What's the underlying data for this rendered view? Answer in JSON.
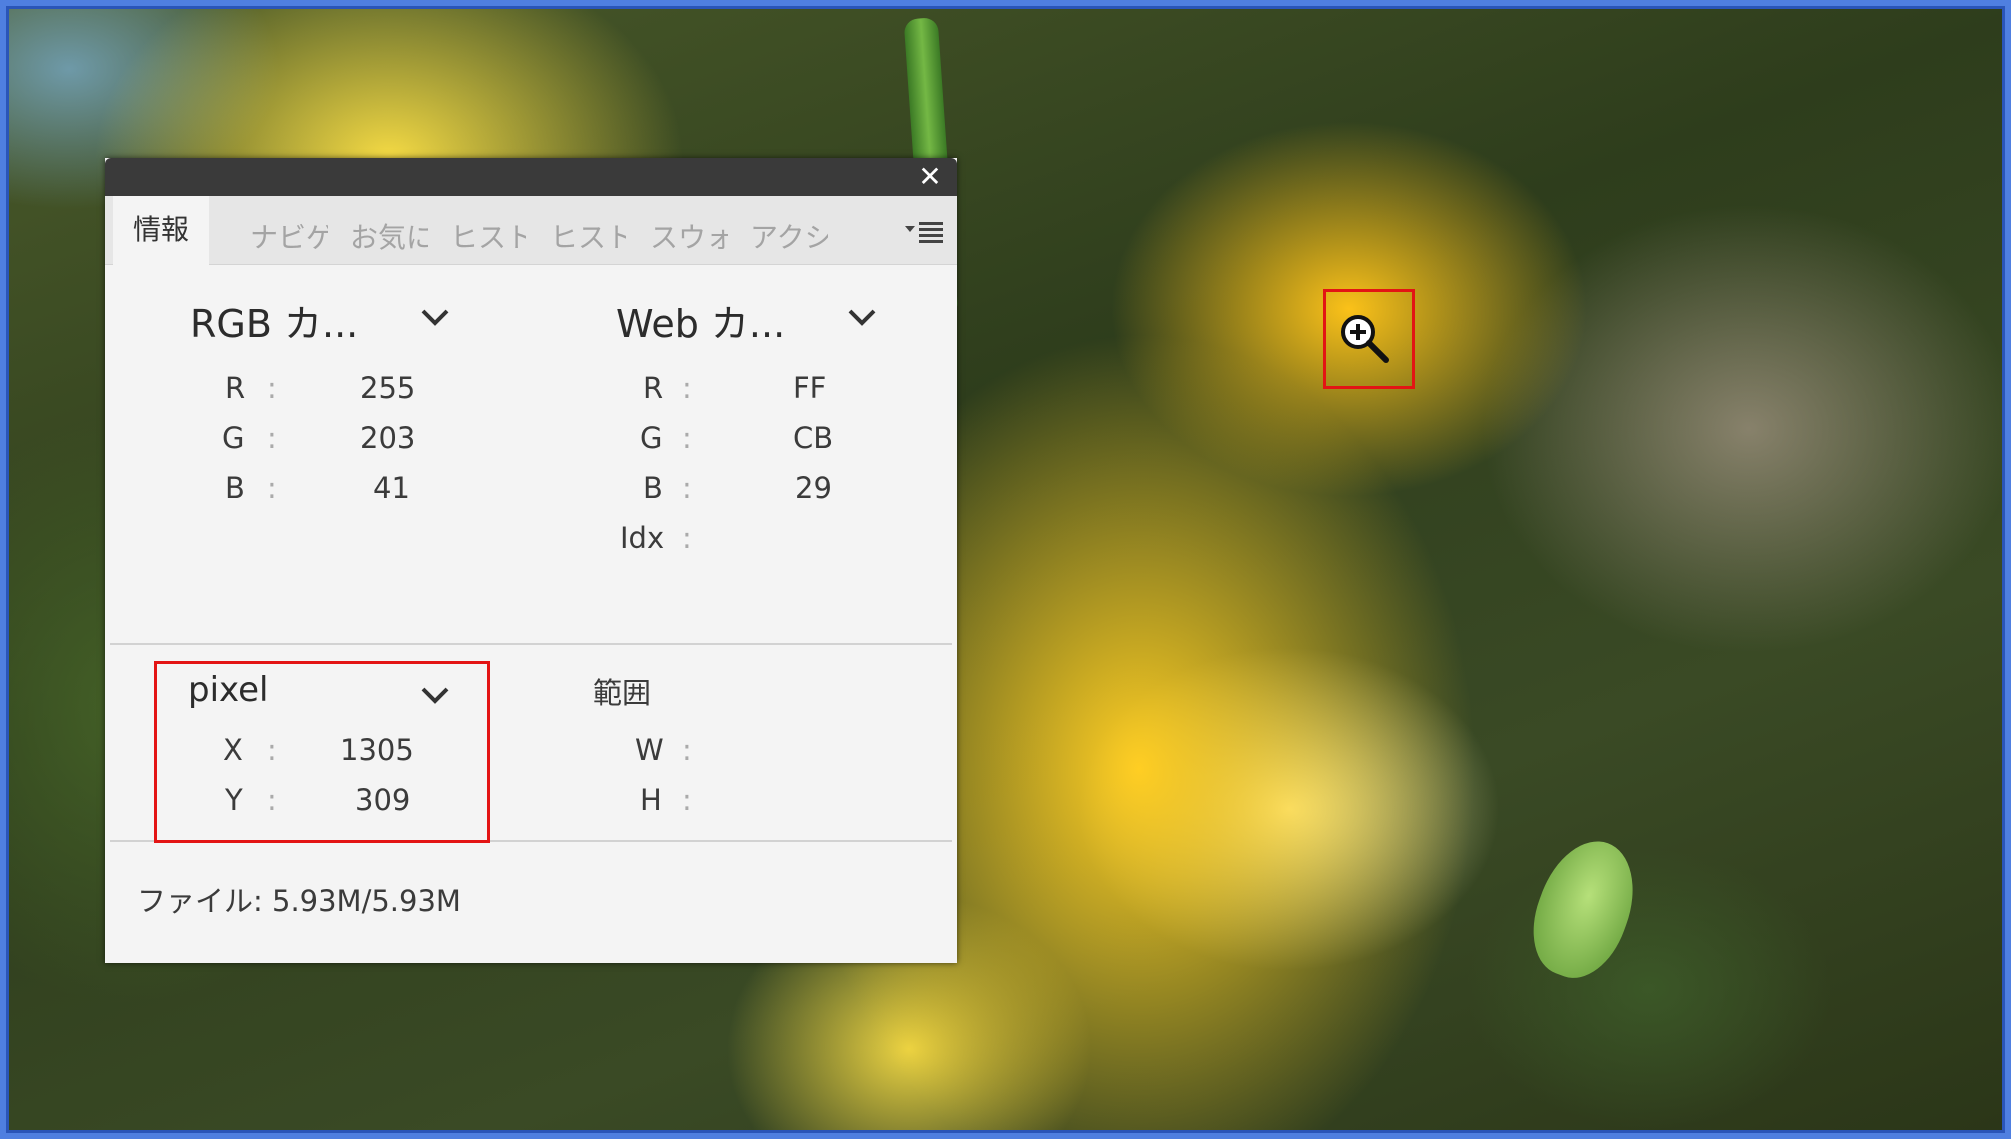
{
  "panel": {
    "close_label": "✕",
    "tabs": [
      "情報",
      "ナビゲ",
      "お気に",
      "ヒスト",
      "ヒスト",
      "スウォ",
      "アクシ"
    ],
    "rgb": {
      "header": "RGB カ...",
      "rows": [
        {
          "k": "R",
          "sep": ":",
          "v": "255"
        },
        {
          "k": "G",
          "sep": ":",
          "v": "203"
        },
        {
          "k": "B",
          "sep": ":",
          "v": "41"
        }
      ]
    },
    "web": {
      "header": "Web カ...",
      "rows": [
        {
          "k": "R",
          "sep": ":",
          "v": "FF"
        },
        {
          "k": "G",
          "sep": ":",
          "v": "CB"
        },
        {
          "k": "B",
          "sep": ":",
          "v": "29"
        },
        {
          "k": "Idx",
          "sep": ":",
          "v": ""
        }
      ]
    },
    "pixel": {
      "header": "pixel",
      "rows": [
        {
          "k": "X",
          "sep": ":",
          "v": "1305"
        },
        {
          "k": "Y",
          "sep": ":",
          "v": "309"
        }
      ]
    },
    "range": {
      "header": "範囲",
      "rows": [
        {
          "k": "W",
          "sep": ":",
          "v": ""
        },
        {
          "k": "H",
          "sep": ":",
          "v": ""
        }
      ]
    },
    "file_info": "ファイル: 5.93M/5.93M"
  },
  "colors": {
    "highlight": "#e31414",
    "frame": "#4f7fe0",
    "panel_bg": "#f4f4f4",
    "titlebar": "#3a3a3a"
  },
  "icons": {
    "zoom": "zoom-in-icon",
    "close": "close-icon",
    "menu": "panel-menu-icon",
    "dropdown": "chevron-down-icon"
  }
}
